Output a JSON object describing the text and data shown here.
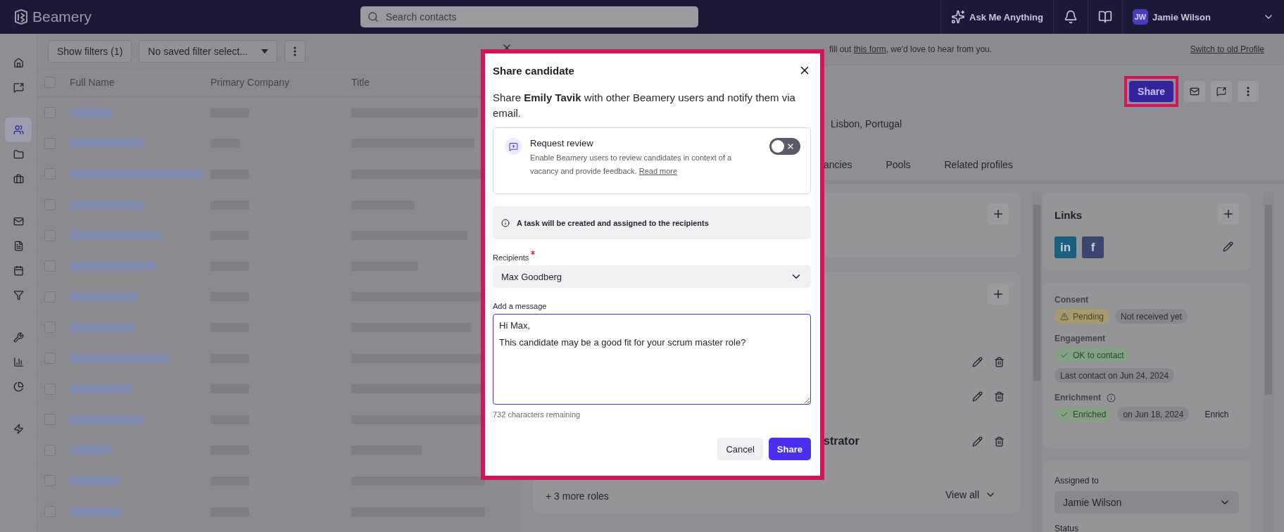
{
  "topbar": {
    "logo": "Beamery",
    "search": {
      "placeholder": "Search contacts"
    },
    "assistant": "Ask Me Anything",
    "user": {
      "initials": "JW",
      "name": "Jamie Wilson"
    }
  },
  "sidebar": {
    "groups": [
      [
        {
          "kind": "home",
          "selected": false
        },
        {
          "kind": "chat",
          "selected": false
        }
      ],
      [
        {
          "kind": "contacts",
          "selected": true
        },
        {
          "kind": "folder",
          "selected": false
        },
        {
          "kind": "briefcase",
          "selected": false
        }
      ],
      [
        {
          "kind": "mail",
          "selected": false
        },
        {
          "kind": "file",
          "selected": false
        },
        {
          "kind": "calendar",
          "selected": false
        },
        {
          "kind": "filter",
          "selected": false
        }
      ],
      [
        {
          "kind": "wrench",
          "selected": false
        },
        {
          "kind": "bars",
          "selected": false
        },
        {
          "kind": "pie",
          "selected": false
        }
      ],
      [
        {
          "kind": "bolt",
          "selected": false
        }
      ]
    ]
  },
  "contacts": {
    "filters_button": "Show filters (1)",
    "saved_filter": "No saved filter select...",
    "header_checked": false,
    "columns": [
      "Full Name",
      "Primary Company",
      "Title"
    ],
    "rows": [
      {
        "checked": false
      },
      {
        "checked": false
      },
      {
        "checked": false
      },
      {
        "checked": false
      },
      {
        "checked": false
      },
      {
        "checked": false
      },
      {
        "checked": false
      },
      {
        "checked": false
      },
      {
        "checked": false
      },
      {
        "checked": false
      },
      {
        "checked": false
      },
      {
        "checked": false
      },
      {
        "checked": false
      },
      {
        "checked": false
      }
    ]
  },
  "profile": {
    "banner": {
      "text_before": "fill out ",
      "link": "this form",
      "text_after": ", we'd love to hear from you.",
      "switch_link": "Switch to old Profile"
    },
    "actions": [
      {
        "kind": "share",
        "label": "Share",
        "highlighted": true
      },
      {
        "kind": "mail"
      },
      {
        "kind": "chat"
      },
      {
        "kind": "more"
      }
    ],
    "location": "Lisbon, Portugal",
    "tabs": [
      "ancies",
      "Pools",
      "Related profiles"
    ],
    "roles": {
      "partial_title": "strator",
      "more": "+ 3 more roles",
      "view_all": "View all"
    },
    "links": {
      "title": "Links",
      "items": [
        {
          "kind": "linkedin",
          "label": "in"
        },
        {
          "kind": "facebook",
          "label": "f"
        }
      ]
    },
    "status": [
      {
        "label": "Consent",
        "tags": [
          {
            "kind": "warning",
            "label": "Pending"
          },
          {
            "kind": "neutral",
            "label": "Not received yet"
          }
        ]
      },
      {
        "label": "Engagement",
        "tags": [
          {
            "kind": "success",
            "label": "OK to contact"
          },
          {
            "kind": "neutral",
            "label": "Last contact on Jun 24, 2024"
          }
        ]
      },
      {
        "label": "Enrichment",
        "info": true,
        "tags": [
          {
            "kind": "success",
            "label": "Enriched"
          },
          {
            "kind": "neutral",
            "label": "on Jun 18, 2024"
          },
          {
            "kind": "action",
            "label": "Enrich"
          }
        ]
      }
    ],
    "assigned": {
      "label": "Assigned to",
      "value": "Jamie Wilson"
    },
    "status_label": "Status"
  },
  "modal": {
    "title": "Share candidate",
    "description": "Share **Emily Tavik** with other Beamery users and notify them via email.",
    "review": {
      "title": "Request review",
      "description": "Enable Beamery users to review candidates in context of a vacancy and provide feedback.",
      "link": "Read more",
      "on": false
    },
    "info": "A task will be created and assigned to the recipients",
    "recipients": {
      "label": "Recipients",
      "required": true,
      "value": "Max Goodberg"
    },
    "message": {
      "label": "Add a message",
      "value": "Hi Max,\nThis candidate may be a good fit for your scrum master role?"
    },
    "remaining": "732 characters remaining",
    "buttons": [
      {
        "kind": "secondary",
        "label": "Cancel"
      },
      {
        "kind": "primary",
        "label": "Share"
      }
    ]
  }
}
